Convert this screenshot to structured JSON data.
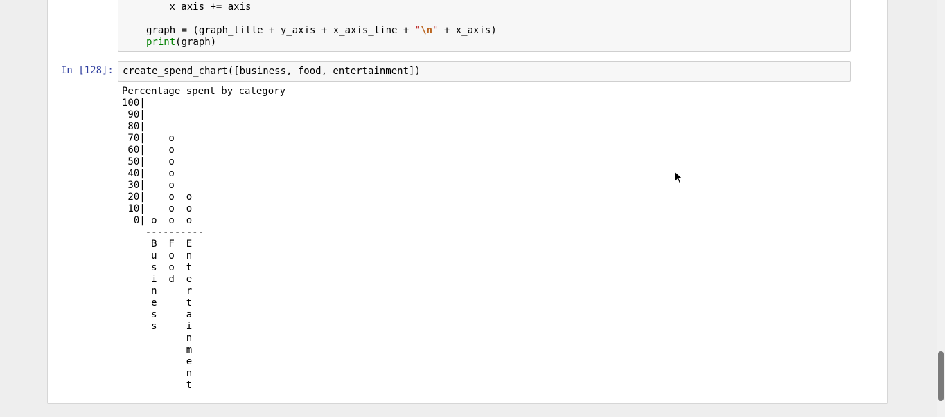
{
  "cell_previous": {
    "lines": [
      {
        "indent": "    ",
        "text": "x_axis += axis"
      },
      {
        "indent": "",
        "text": ""
      },
      {
        "indent": "",
        "pre": "graph = (graph_title + y_axis + x_axis_line + ",
        "str": "\"\\n\"",
        "post": " + x_axis)"
      },
      {
        "indent": "",
        "builtin": "print",
        "post": "(graph)"
      }
    ]
  },
  "cell_current": {
    "prompt": "In [128]:",
    "code": "create_spend_chart([business, food, entertainment])"
  },
  "output": {
    "lines": [
      "Percentage spent by category",
      "100|          ",
      " 90|          ",
      " 80|          ",
      " 70|    o     ",
      " 60|    o     ",
      " 50|    o     ",
      " 40|    o     ",
      " 30|    o     ",
      " 20|    o  o  ",
      " 10|    o  o  ",
      "  0| o  o  o  ",
      "    ----------",
      "     B  F  E  ",
      "     u  o  n  ",
      "     s  o  t  ",
      "     i  d  e  ",
      "     n     r  ",
      "     e     t  ",
      "     s     a  ",
      "     s     i  ",
      "           n  ",
      "           m  ",
      "           e  ",
      "           n  ",
      "           t  "
    ]
  },
  "icons": {
    "cursor": "mouse-pointer-icon"
  }
}
